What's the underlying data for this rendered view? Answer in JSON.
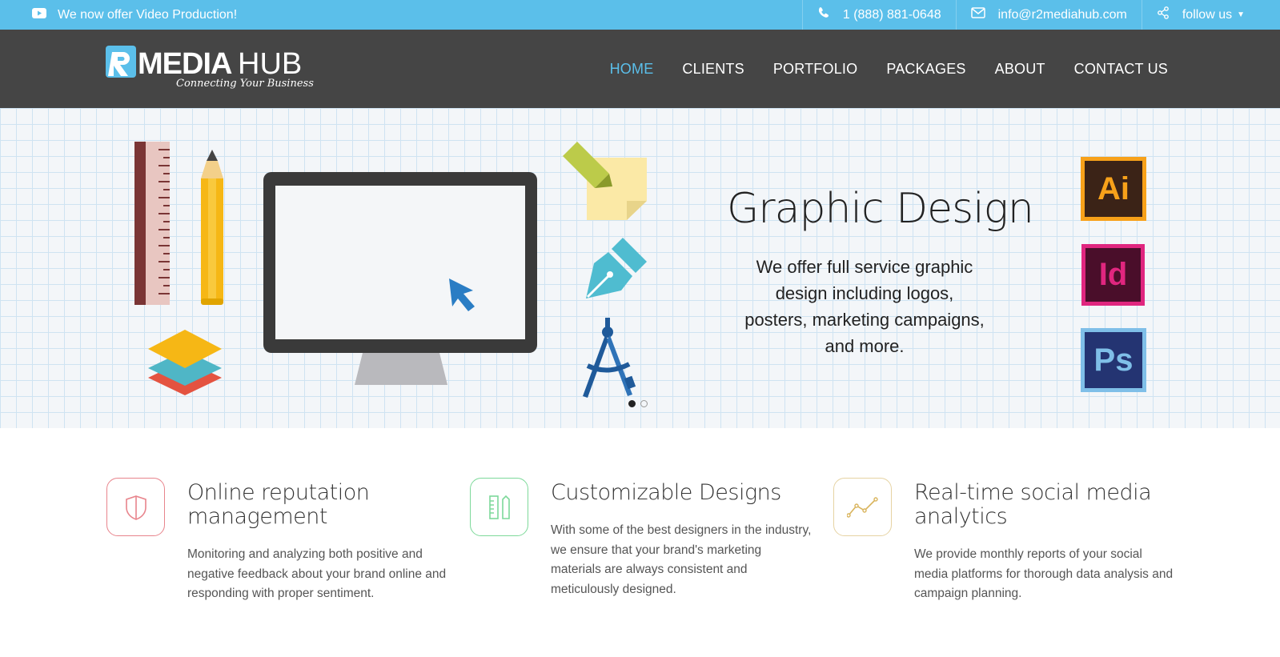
{
  "topbar": {
    "promo_text": "We now offer Video Production!",
    "phone": "1 (888) 881-0648",
    "email": "info@r2mediahub.com",
    "follow": "follow us",
    "icons": [
      "youtube-icon",
      "phone-icon",
      "mail-icon",
      "share-icon",
      "caret-down-icon"
    ]
  },
  "logo": {
    "brand_mark": "R2",
    "brand_media": "MEDIA",
    "brand_hub": "HUB",
    "tagline": "Connecting Your Business"
  },
  "nav": {
    "items": [
      "HOME",
      "CLIENTS",
      "PORTFOLIO",
      "PACKAGES",
      "ABOUT",
      "CONTACT US"
    ],
    "active": "HOME"
  },
  "hero": {
    "title": "Graphic Design",
    "description": "We offer full service graphic design including logos, posters, marketing campaigns, and more.",
    "app_icons": [
      "Ai",
      "Id",
      "Ps"
    ],
    "slides": 2,
    "current_slide": 1
  },
  "features": [
    {
      "title": "Online reputation management",
      "text": "Monitoring and analyzing both positive and negative feedback about your brand online and responding with proper sentiment.",
      "icon": "shield-icon",
      "color": "#e8848c"
    },
    {
      "title": "Customizable Designs",
      "text": "With some of the best designers in the industry, we ensure that your brand's marketing materials are always consistent and meticulously designed.",
      "icon": "ruler-pencil-icon",
      "color": "#7dd99a"
    },
    {
      "title": "Real-time social media analytics",
      "text": "We provide monthly reports of your social media platforms for thorough data analysis and campaign planning.",
      "icon": "line-chart-icon",
      "color": "#d9b45c"
    }
  ],
  "colors": {
    "accent": "#5bbfea",
    "nav_bg": "#454545"
  }
}
